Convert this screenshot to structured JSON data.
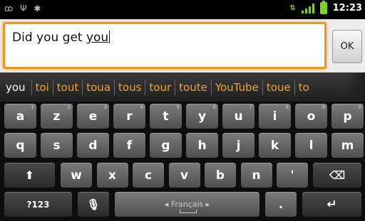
{
  "status_bar": {
    "left_icons": [
      "voicemail-icon",
      "usb-icon",
      "android-debug-icon"
    ],
    "time": "12:23",
    "colors": {
      "signal": "#7ed321",
      "battery": "#7ed321"
    }
  },
  "edit": {
    "typed": "Did you get ",
    "composing": "you",
    "ok_label": "OK",
    "accent": "#f3941b"
  },
  "suggestions": [
    "you",
    "toi",
    "tout",
    "toua",
    "tous",
    "tour",
    "toute",
    "YouTube",
    "toue",
    "to"
  ],
  "keyboard": {
    "row1": [
      {
        "label": "a",
        "hint": "1"
      },
      {
        "label": "z",
        "hint": "2"
      },
      {
        "label": "e",
        "hint": "3"
      },
      {
        "label": "r",
        "hint": "4"
      },
      {
        "label": "t",
        "hint": "5"
      },
      {
        "label": "y",
        "hint": "6"
      },
      {
        "label": "u",
        "hint": "7"
      },
      {
        "label": "i",
        "hint": "8"
      },
      {
        "label": "o",
        "hint": "9"
      },
      {
        "label": "p",
        "hint": "0"
      }
    ],
    "row2": [
      "q",
      "s",
      "d",
      "f",
      "g",
      "h",
      "j",
      "k",
      "l",
      "m"
    ],
    "row3": [
      "w",
      "x",
      "c",
      "v",
      "b",
      "n",
      "'"
    ],
    "mode_label": "?123",
    "space_label": "◂ Français ▸",
    "period_label": "."
  }
}
